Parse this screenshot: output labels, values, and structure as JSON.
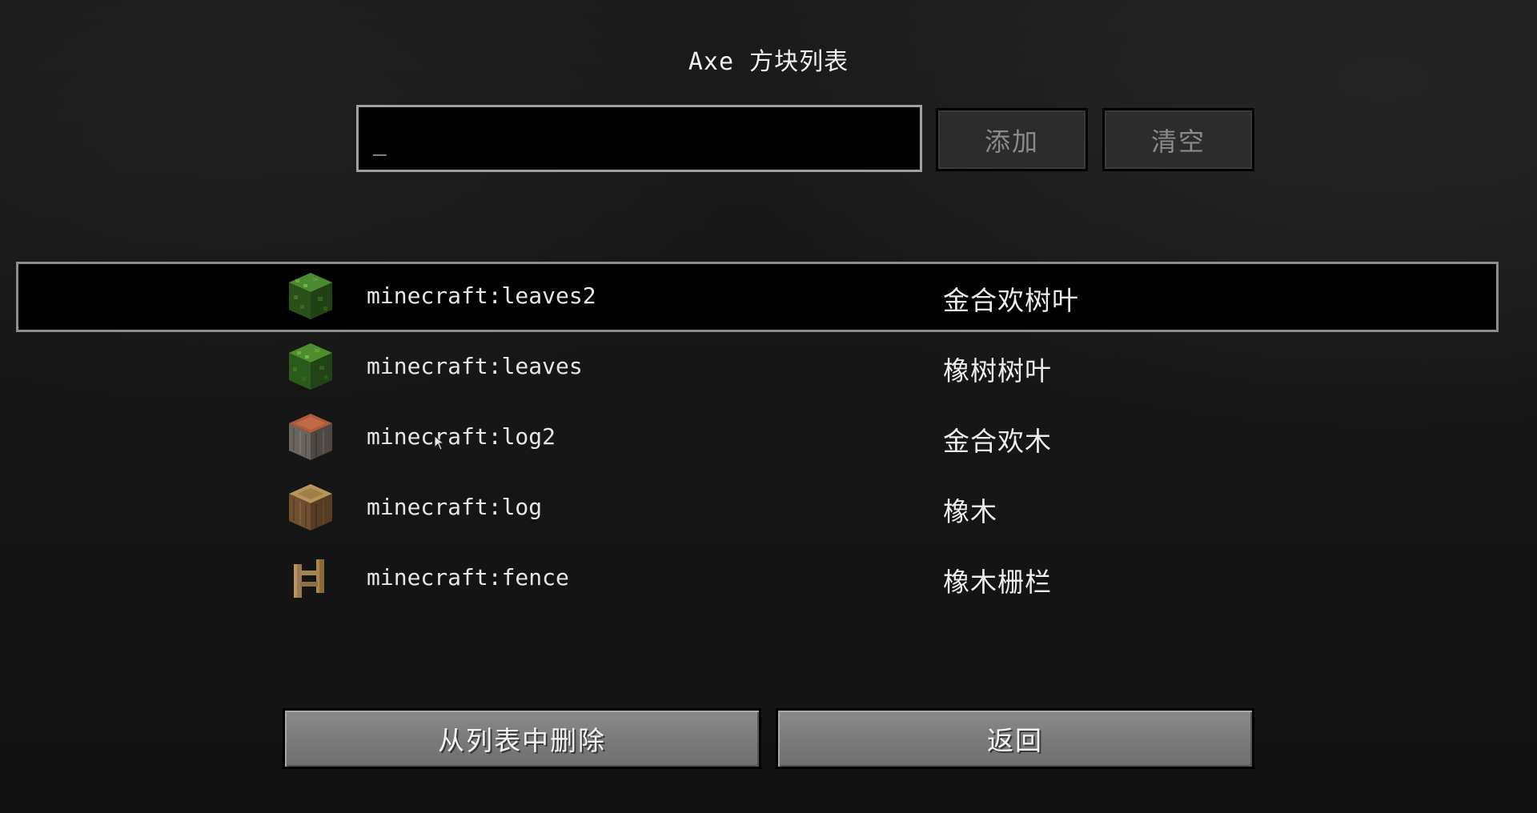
{
  "title": "Axe 方块列表",
  "search": {
    "value": "_"
  },
  "buttons": {
    "add": "添加",
    "clear": "清空",
    "remove": "从列表中删除",
    "back": "返回"
  },
  "blocks": [
    {
      "id": "minecraft:leaves2",
      "name": "金合欢树叶",
      "icon": "acacia-leaves-icon",
      "selected": true
    },
    {
      "id": "minecraft:leaves",
      "name": "橡树树叶",
      "icon": "oak-leaves-icon",
      "selected": false
    },
    {
      "id": "minecraft:log2",
      "name": "金合欢木",
      "icon": "acacia-log-icon",
      "selected": false
    },
    {
      "id": "minecraft:log",
      "name": "橡木",
      "icon": "oak-log-icon",
      "selected": false
    },
    {
      "id": "minecraft:fence",
      "name": "橡木栅栏",
      "icon": "oak-fence-icon",
      "selected": false
    }
  ]
}
